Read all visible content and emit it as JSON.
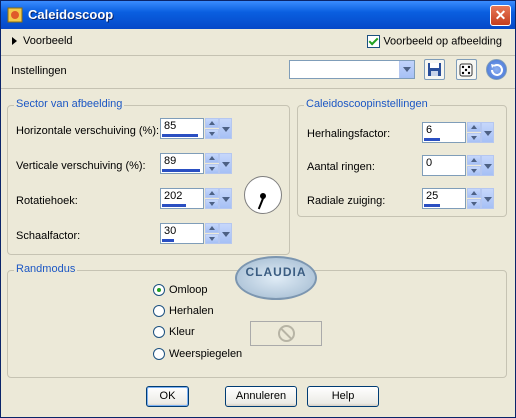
{
  "window": {
    "title": "Caleidoscoop",
    "close_label": "✕"
  },
  "preview": {
    "label": "Voorbeeld",
    "on_image_label": "Voorbeeld op afbeelding",
    "on_image_checked": true
  },
  "settings": {
    "label": "Instellingen",
    "preset_value": ""
  },
  "sector": {
    "title": "Sector van afbeelding",
    "fields": [
      {
        "label": "Horizontale verschuiving (%):",
        "value": "85"
      },
      {
        "label": "Verticale verschuiving (%):",
        "value": "89"
      },
      {
        "label": "Rotatiehoek:",
        "value": "202"
      },
      {
        "label": "Schaalfactor:",
        "value": "30"
      }
    ]
  },
  "kaleido": {
    "title": "Caleidoscoopinstellingen",
    "fields": [
      {
        "label": "Herhalingsfactor:",
        "value": "6"
      },
      {
        "label": "Aantal ringen:",
        "value": "0"
      },
      {
        "label": "Radiale zuiging:",
        "value": "25"
      }
    ]
  },
  "edge_mode": {
    "title": "Randmodus",
    "options": [
      {
        "label": "Omloop",
        "selected": true
      },
      {
        "label": "Herhalen",
        "selected": false
      },
      {
        "label": "Kleur",
        "selected": false
      },
      {
        "label": "Weerspiegelen",
        "selected": false
      }
    ]
  },
  "watermark": {
    "text": "CLAUDIA"
  },
  "buttons": {
    "ok": "OK",
    "cancel": "Annuleren",
    "help": "Help"
  },
  "colors": {
    "title_bar": "#0a5fe0",
    "group_title": "#1c57c4",
    "progress_bar": "#2a4fc2",
    "dialog_bg": "#ece9d8"
  }
}
